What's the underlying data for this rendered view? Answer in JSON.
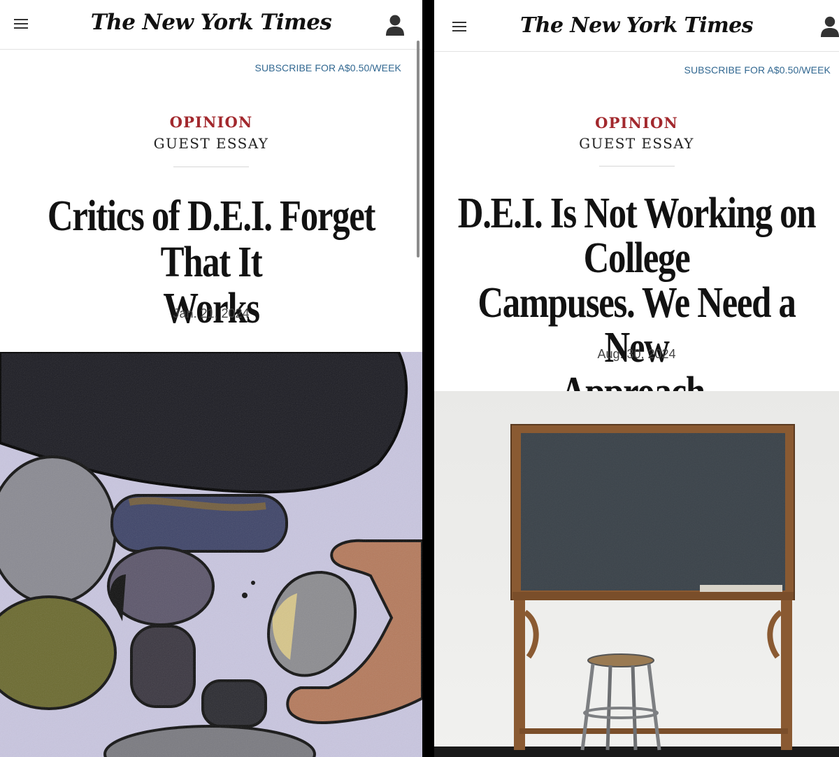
{
  "left": {
    "masthead": "The New York Times",
    "subscribe": "SUBSCRIBE FOR A$0.50/WEEK",
    "kicker": "OPINION",
    "section": "GUEST ESSAY",
    "headline_lines": [
      "Critics of D.E.I. Forget That It",
      "Works"
    ],
    "date": "Jan. 21, 2024",
    "hero_image": "illustration of stacked stones and a hand holding a rock"
  },
  "right": {
    "masthead": "The New York Times",
    "subscribe": "SUBSCRIBE FOR A$0.50/WEEK",
    "kicker": "OPINION",
    "section": "GUEST ESSAY",
    "headline_lines": [
      "D.E.I. Is Not Working on College",
      "Campuses. We Need a New",
      "Approach."
    ],
    "date": "Aug. 30, 2024",
    "hero_image": "photo of a wooden chalkboard and a metal stool"
  },
  "icons": {
    "menu": "hamburger-menu-icon",
    "account": "account-icon"
  }
}
